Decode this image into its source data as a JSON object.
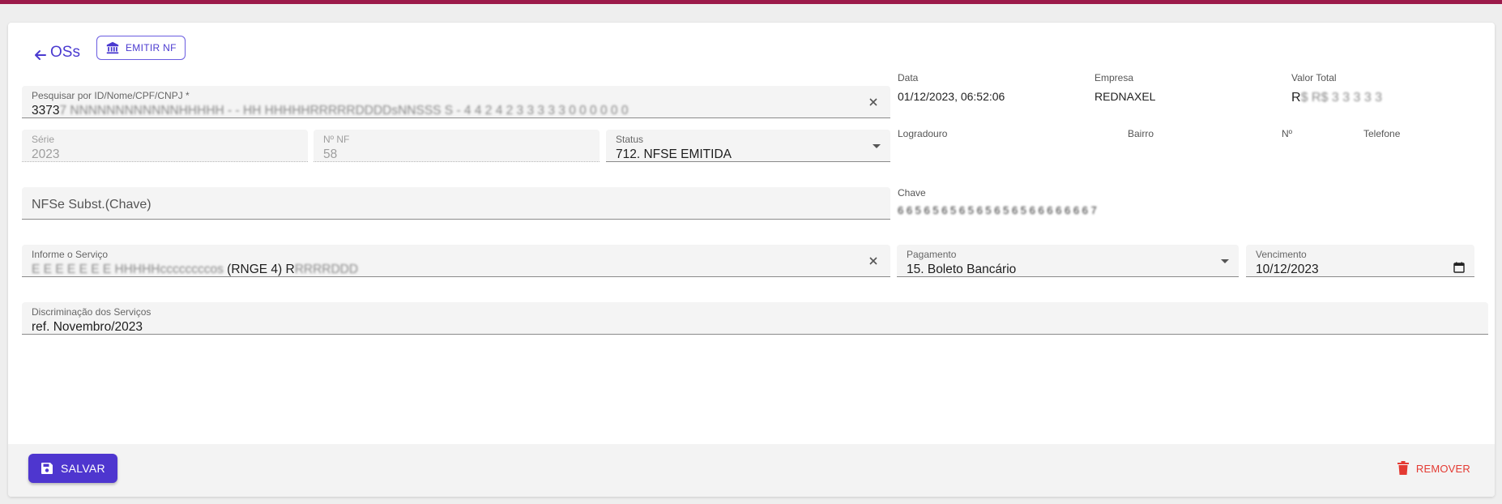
{
  "header": {
    "back_label": "OSs",
    "emit_nf_label": "EMITIR NF"
  },
  "form": {
    "search": {
      "label": "Pesquisar por ID/Nome/CPF/CNPJ *",
      "value_prefix": "3373",
      "value_blurred": "7 NNNNNNNNNNNNHHHHH - - HH HHHHHRRRRRDDDDsNNSSS  S - 4 4 2 4 2 3 3 3 3 3 0 0 0 0 0 0"
    },
    "serie": {
      "label": "Série",
      "value": "2023"
    },
    "nf_number": {
      "label": "Nº NF",
      "value": "58"
    },
    "status": {
      "label": "Status",
      "value": "712. NFSE EMITIDA"
    },
    "nfse_subst": {
      "placeholder": "NFSe Subst.(Chave)"
    },
    "servico": {
      "label": "Informe o Serviço",
      "value_blurred_prefix": "E E E E E E E HHHHHccccccccos",
      "value_visible": " (RNGE 4)  R",
      "value_blurred_suffix": "RRRRDDD"
    },
    "pagamento": {
      "label": "Pagamento",
      "value": "15. Boleto Bancário"
    },
    "vencimento": {
      "label": "Vencimento",
      "value": "10/12/2023"
    },
    "discriminacao": {
      "label": "Discriminação dos Serviços",
      "value": "ref. Novembro/2023"
    }
  },
  "info": {
    "data": {
      "label": "Data",
      "value": "01/12/2023, 06:52:06"
    },
    "empresa": {
      "label": "Empresa",
      "value": "REDNAXEL"
    },
    "valor_total": {
      "label": "Valor Total",
      "value_prefix": "R",
      "value_blurred": "$ R$ 3 3 3 3 3"
    },
    "logradouro": {
      "label": "Logradouro"
    },
    "bairro": {
      "label": "Bairro"
    },
    "numero": {
      "label": "Nº"
    },
    "telefone": {
      "label": "Telefone"
    },
    "chave": {
      "label": "Chave",
      "value_blurred": "6 6 5 6 5 6 5 6 5 6 5 6 5 6 5 6 6 6 6 6 6 6 7"
    }
  },
  "footer": {
    "save_label": "SALVAR",
    "remove_label": "REMOVER"
  },
  "colors": {
    "accent": "#4e36cf",
    "top_bar": "#9c1a4a",
    "danger": "#e43a32"
  }
}
